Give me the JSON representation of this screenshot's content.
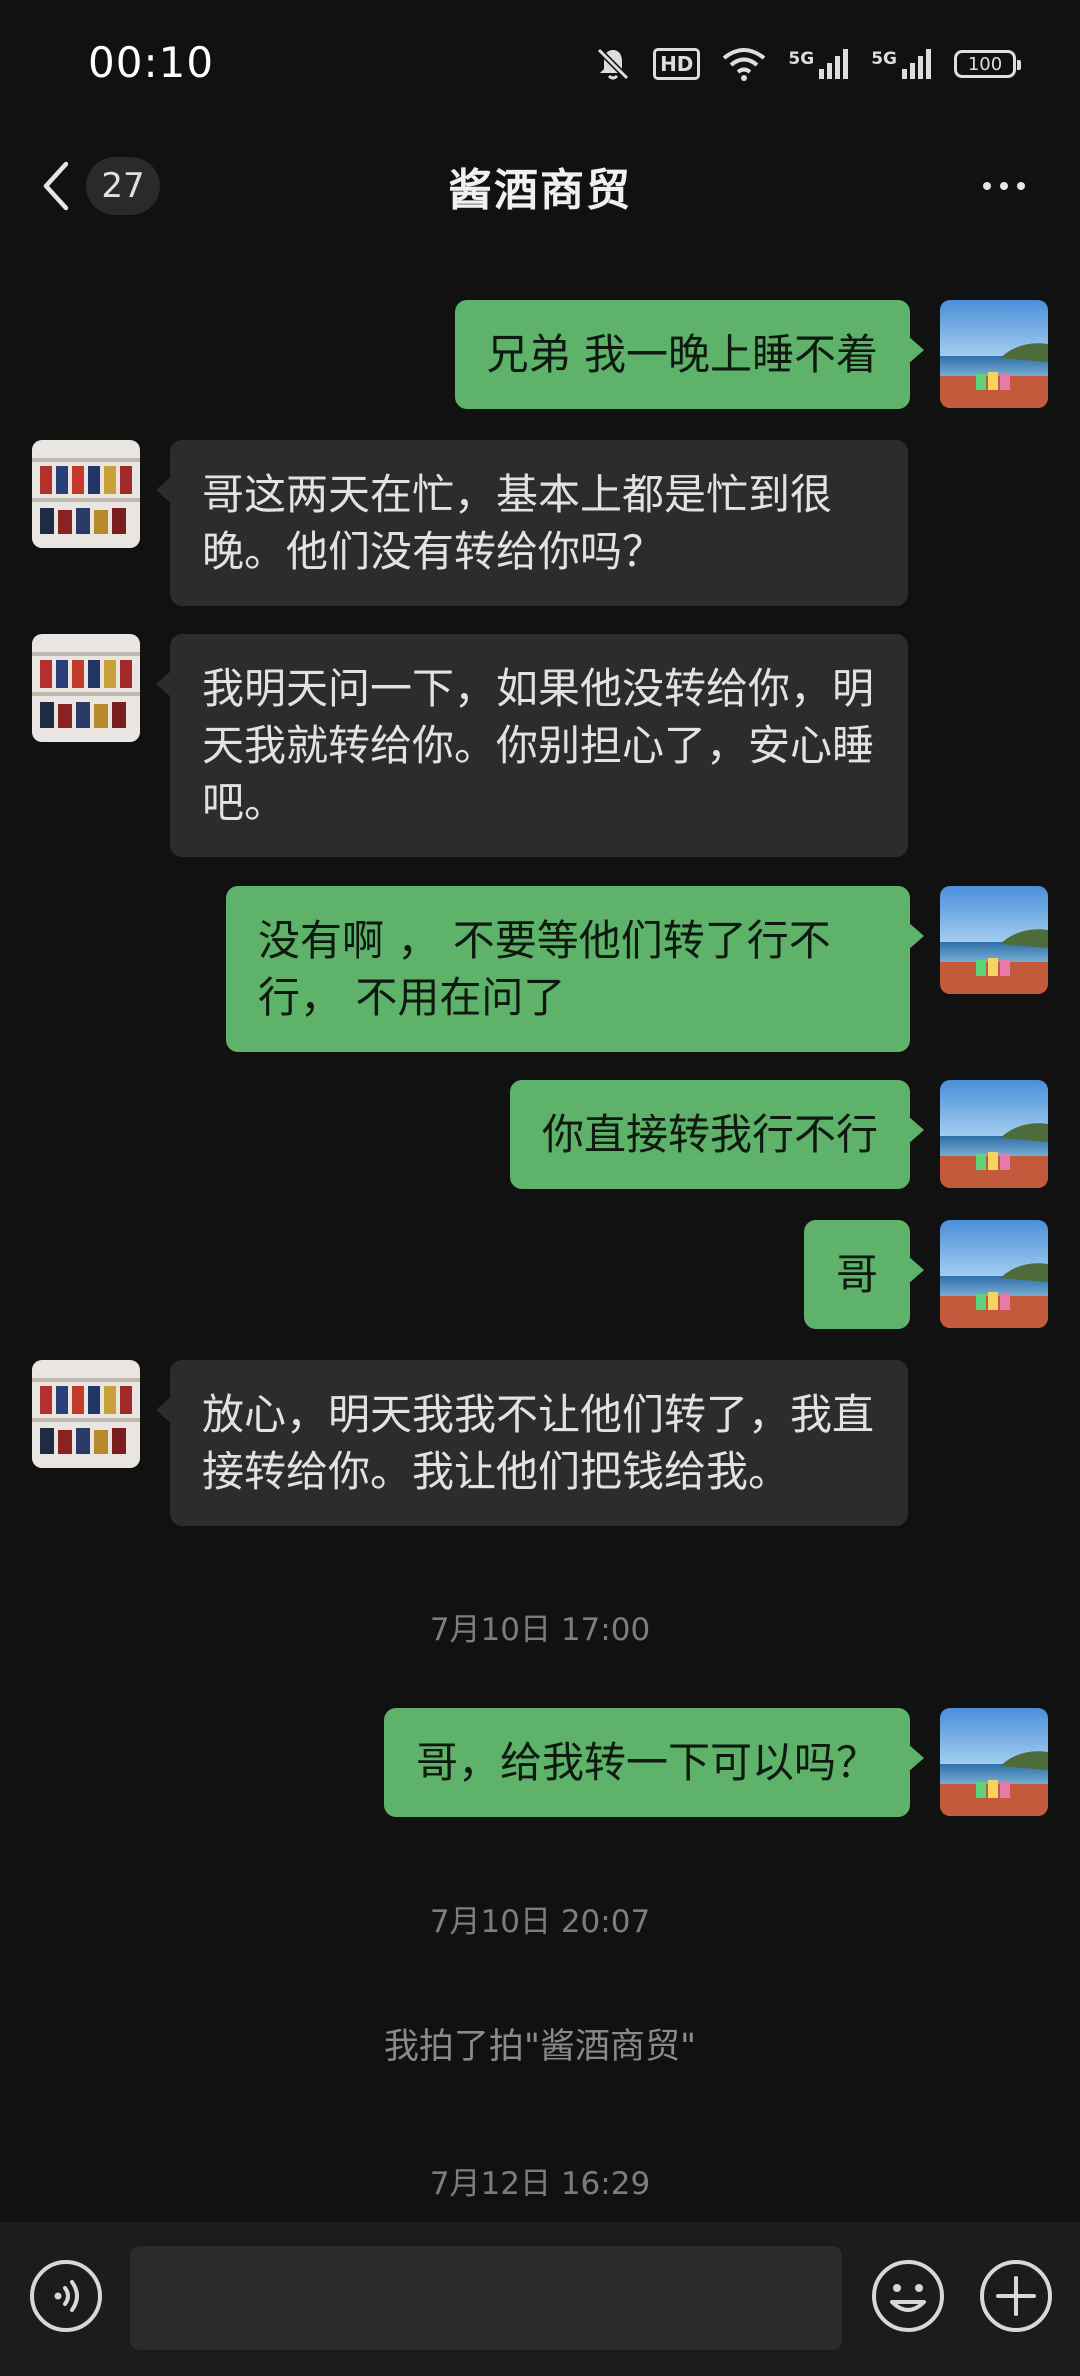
{
  "status_bar": {
    "time": "00:10",
    "icons": [
      "mute-icon",
      "hd-icon",
      "wifi-icon",
      "5g-signal-icon",
      "5g-signal-icon",
      "battery-icon"
    ],
    "hd_label": "HD",
    "network_1": "5G",
    "network_2": "5G",
    "battery": "100"
  },
  "header": {
    "unread_count": "27",
    "title": "酱酒商贸"
  },
  "messages": [
    {
      "from": "me",
      "text": "兄弟 我一晚上睡不着"
    },
    {
      "from": "other",
      "text": "哥这两天在忙，基本上都是忙到很晚。他们没有转给你吗？"
    },
    {
      "from": "other",
      "text": "我明天问一下，如果他没转给你，明天我就转给你。你别担心了，安心睡吧。"
    },
    {
      "from": "me",
      "text": "没有啊 ， 不要等他们转了行不行， 不用在问了"
    },
    {
      "from": "me",
      "text": "你直接转我行不行"
    },
    {
      "from": "me",
      "text": "哥"
    },
    {
      "from": "other",
      "text": "放心，明天我我不让他们转了，我直接转给你。我让他们把钱给我。"
    },
    {
      "type": "time",
      "text": "7月10日 17:00"
    },
    {
      "from": "me",
      "text": "哥，给我转一下可以吗？"
    },
    {
      "type": "time",
      "text": "7月10日 20:07"
    },
    {
      "type": "system",
      "text": "我拍了拍\"酱酒商贸\""
    },
    {
      "type": "time",
      "text": "7月12日 16:29"
    }
  ],
  "input": {
    "placeholder": "",
    "value": ""
  },
  "colors": {
    "background": "#111111",
    "my_bubble": "#5fb26a",
    "other_bubble": "#2c2c2c"
  }
}
